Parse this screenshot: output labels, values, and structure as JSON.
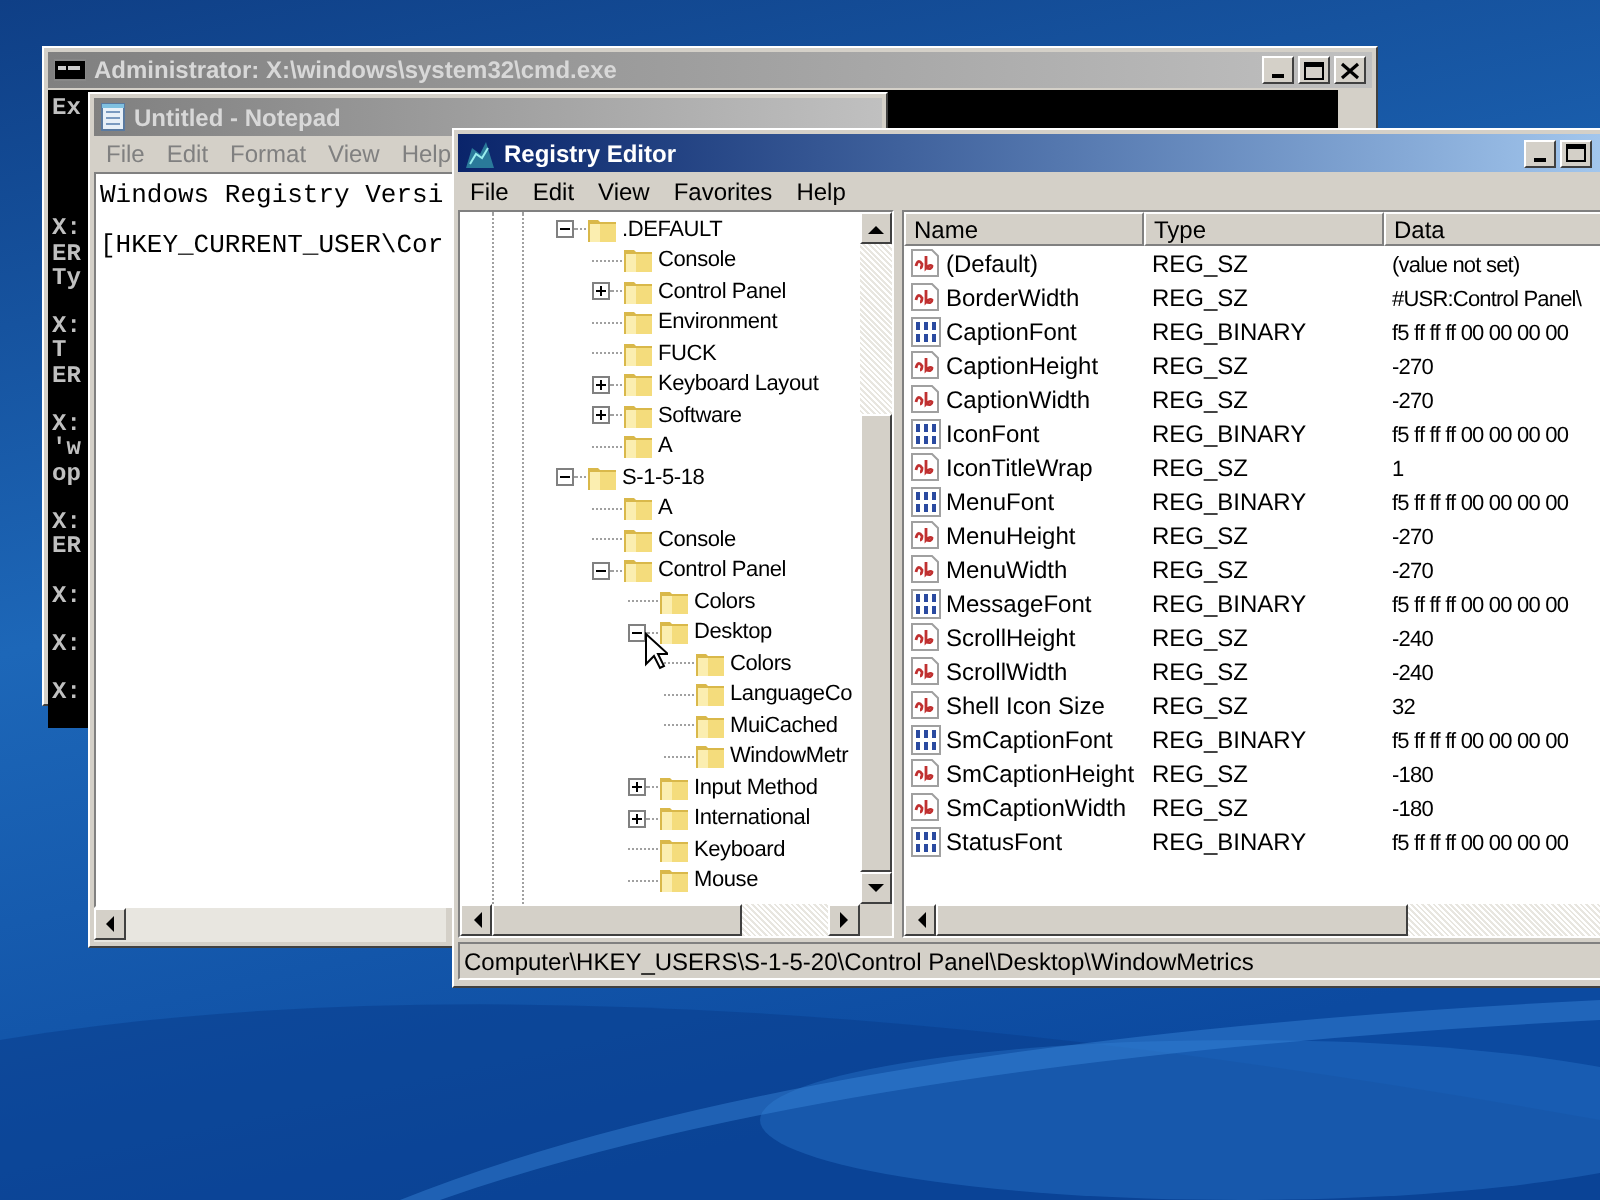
{
  "cmd_window": {
    "title": "Administrator: X:\\windows\\system32\\cmd.exe",
    "active": false,
    "blocks": [
      [
        "Ex"
      ],
      [
        "X:",
        "ER",
        "Ty"
      ],
      [
        "X:",
        "T",
        "ER"
      ],
      [
        "X:",
        "'w",
        "op"
      ],
      [
        "X:",
        "ER"
      ],
      [
        "X:"
      ],
      [
        "X:"
      ],
      [
        "X:"
      ]
    ]
  },
  "notepad_window": {
    "title": "Untitled - Notepad",
    "active": false,
    "menu": [
      "File",
      "Edit",
      "Format",
      "View",
      "Help"
    ],
    "lines": [
      "Windows Registry Versi",
      "[HKEY_CURRENT_USER\\Cor"
    ]
  },
  "regedit_window": {
    "title": "Registry Editor",
    "active": true,
    "menu": [
      "File",
      "Edit",
      "View",
      "Favorites",
      "Help"
    ],
    "tree": [
      {
        "label": ".DEFAULT",
        "expanded": true,
        "children": [
          {
            "label": "Console"
          },
          {
            "label": "Control Panel",
            "expanded": false
          },
          {
            "label": "Environment"
          },
          {
            "label": "FUCK"
          },
          {
            "label": "Keyboard Layout",
            "expanded": false
          },
          {
            "label": "Software",
            "expanded": false
          },
          {
            "label": "A"
          }
        ]
      },
      {
        "label": "S-1-5-18",
        "expanded": true,
        "children": [
          {
            "label": "A"
          },
          {
            "label": "Console"
          },
          {
            "label": "Control Panel",
            "expanded": true,
            "children": [
              {
                "label": "Colors"
              },
              {
                "label": "Desktop",
                "expanded": true,
                "children": [
                  {
                    "label": "Colors"
                  },
                  {
                    "label": "LanguageCo"
                  },
                  {
                    "label": "MuiCached"
                  },
                  {
                    "label": "WindowMetr"
                  }
                ]
              },
              {
                "label": "Input Method",
                "expanded": false
              },
              {
                "label": "International",
                "expanded": false
              },
              {
                "label": "Keyboard"
              },
              {
                "label": "Mouse"
              }
            ]
          }
        ]
      }
    ],
    "columns": [
      "Name",
      "Type",
      "Data"
    ],
    "values": [
      {
        "kind": "string",
        "name": "(Default)",
        "type": "REG_SZ",
        "data": "(value not set)"
      },
      {
        "kind": "string",
        "name": "BorderWidth",
        "type": "REG_SZ",
        "data": "#USR:Control Panel\\"
      },
      {
        "kind": "binary",
        "name": "CaptionFont",
        "type": "REG_BINARY",
        "data": "f5 ff ff ff 00 00 00 00"
      },
      {
        "kind": "string",
        "name": "CaptionHeight",
        "type": "REG_SZ",
        "data": "-270"
      },
      {
        "kind": "string",
        "name": "CaptionWidth",
        "type": "REG_SZ",
        "data": "-270"
      },
      {
        "kind": "binary",
        "name": "IconFont",
        "type": "REG_BINARY",
        "data": "f5 ff ff ff 00 00 00 00"
      },
      {
        "kind": "string",
        "name": "IconTitleWrap",
        "type": "REG_SZ",
        "data": "1"
      },
      {
        "kind": "binary",
        "name": "MenuFont",
        "type": "REG_BINARY",
        "data": "f5 ff ff ff 00 00 00 00"
      },
      {
        "kind": "string",
        "name": "MenuHeight",
        "type": "REG_SZ",
        "data": "-270"
      },
      {
        "kind": "string",
        "name": "MenuWidth",
        "type": "REG_SZ",
        "data": "-270"
      },
      {
        "kind": "binary",
        "name": "MessageFont",
        "type": "REG_BINARY",
        "data": "f5 ff ff ff 00 00 00 00"
      },
      {
        "kind": "string",
        "name": "ScrollHeight",
        "type": "REG_SZ",
        "data": "-240"
      },
      {
        "kind": "string",
        "name": "ScrollWidth",
        "type": "REG_SZ",
        "data": "-240"
      },
      {
        "kind": "string",
        "name": "Shell Icon Size",
        "type": "REG_SZ",
        "data": "32"
      },
      {
        "kind": "binary",
        "name": "SmCaptionFont",
        "type": "REG_BINARY",
        "data": "f5 ff ff ff 00 00 00 00"
      },
      {
        "kind": "string",
        "name": "SmCaptionHeight",
        "type": "REG_SZ",
        "data": "-180"
      },
      {
        "kind": "string",
        "name": "SmCaptionWidth",
        "type": "REG_SZ",
        "data": "-180"
      },
      {
        "kind": "binary",
        "name": "StatusFont",
        "type": "REG_BINARY",
        "data": "f5 ff ff ff 00 00 00 00"
      }
    ],
    "status_bar": "Computer\\HKEY_USERS\\S-1-5-20\\Control Panel\\Desktop\\WindowMetrics"
  }
}
